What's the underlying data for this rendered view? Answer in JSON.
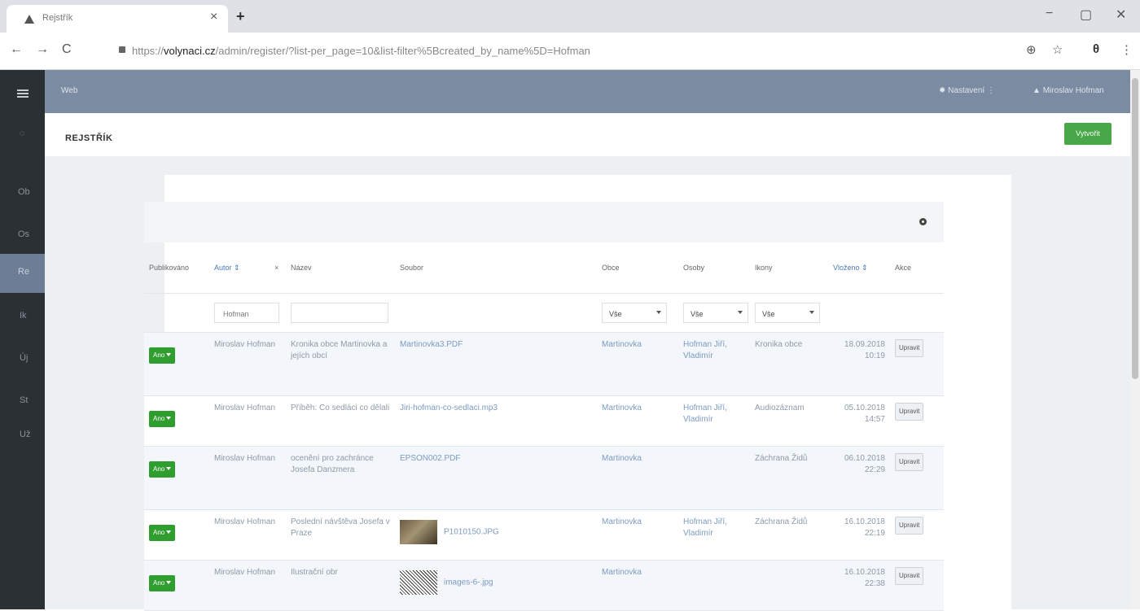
{
  "browser": {
    "tab_title": "Rejstřík",
    "tab_close": "×",
    "new_tab": "+",
    "minimize": "−",
    "restore": "▢",
    "close": "✕",
    "back": "←",
    "forward": "→",
    "reload": "C",
    "url_prefix": "https://",
    "url_domain": "volynaci.cz",
    "url_rest": "/admin/register/?list-per_page=10&list-filter%5Bcreated_by_name%5D=Hofman",
    "zoom_icon": "⊕",
    "star_icon": "☆",
    "profile_icon": "θ",
    "menu_icon": "⋮"
  },
  "sidebar": {
    "items": [
      "Ob",
      "Os",
      "Re",
      "Ik",
      "Új",
      "St",
      "Už"
    ],
    "active": "Re"
  },
  "appbar": {
    "title": "Web",
    "settings": "Nastavení",
    "user": "Miroslav Hofman"
  },
  "page": {
    "title": "REJSTŘÍK",
    "create_button": "Vytvořit"
  },
  "table": {
    "headers": [
      "Publikováno",
      "Autor ⇕",
      "×",
      "Název",
      "Soubor",
      "Obce",
      "Osoby",
      "Ikony",
      "Vloženo ⇕",
      "Akce"
    ],
    "filters": {
      "author": "Hofman",
      "name": "",
      "obce": "Vše",
      "osoby": "Vše",
      "ikony": "Vše"
    },
    "rows": [
      {
        "pub": "Ano",
        "author": "Miroslav Hofman",
        "name": "Kronika obce Martinovka a jejích obcí",
        "file": "Martinovka3.PDF",
        "thumb": "",
        "obce": "Martinovka",
        "osoby": "Hofman Jiří, Vladimír",
        "ikony": "Kronika obce",
        "date": "18.09.2018 10:19",
        "action": "Upravit"
      },
      {
        "pub": "Ano",
        "author": "Miroslav Hofman",
        "name": "Příběh: Co sedláci co dělali",
        "file": "Jiri-hofman-co-sedlaci.mp3",
        "thumb": "",
        "obce": "Martinovka",
        "osoby": "Hofman Jiří, Vladimír",
        "ikony": "Audiozáznam",
        "date": "05.10.2018 14:57",
        "action": "Upravit"
      },
      {
        "pub": "Ano",
        "author": "Miroslav Hofman",
        "name": "ocenění pro zachránce Josefa Danzmera",
        "file": "EPSON002.PDF",
        "thumb": "",
        "obce": "Martinovka",
        "osoby": "",
        "ikony": "Záchrana Židů",
        "date": "06.10.2018 22:29",
        "action": "Upravit"
      },
      {
        "pub": "Ano",
        "author": "Miroslav Hofman",
        "name": "Poslední návštěva Josefa v Praze",
        "file": "P1010150.JPG",
        "thumb": "photo",
        "obce": "Martinovka",
        "osoby": "Hofman Jiří, Vladimír",
        "ikony": "Záchrana Židů",
        "date": "16.10.2018 22:19",
        "action": "Upravit"
      },
      {
        "pub": "Ano",
        "author": "Miroslav Hofman",
        "name": "Ilustrační obr",
        "file": "images-6-.jpg",
        "thumb": "bw",
        "obce": "Martinovka",
        "osoby": "",
        "ikony": "",
        "date": "16.10.2018 22:38",
        "action": "Upravit"
      }
    ]
  }
}
